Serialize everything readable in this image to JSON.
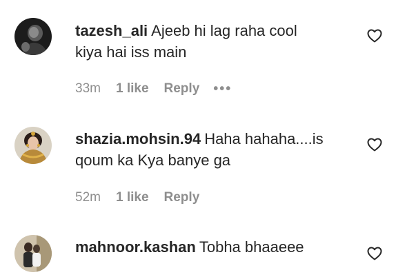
{
  "comments": [
    {
      "username": "tazesh_ali",
      "text_line1": "Ajeeb hi lag raha cool",
      "text_line2": "kiya hai iss main",
      "time": "33m",
      "likes": "1 like",
      "reply": "Reply",
      "more": "•••"
    },
    {
      "username": "shazia.mohsin.94",
      "text_line1": "Haha hahaha....is",
      "text_line2": "qoum ka Kya banye ga",
      "time": "52m",
      "likes": "1 like",
      "reply": "Reply"
    },
    {
      "username": "mahnoor.kashan",
      "text_line1": "Tobha bhaaeee"
    }
  ],
  "icons": {
    "like": "heart-outline-icon",
    "more": "more-options-icon"
  },
  "colors": {
    "primary_text": "#262626",
    "secondary_text": "#8e8e8e"
  }
}
